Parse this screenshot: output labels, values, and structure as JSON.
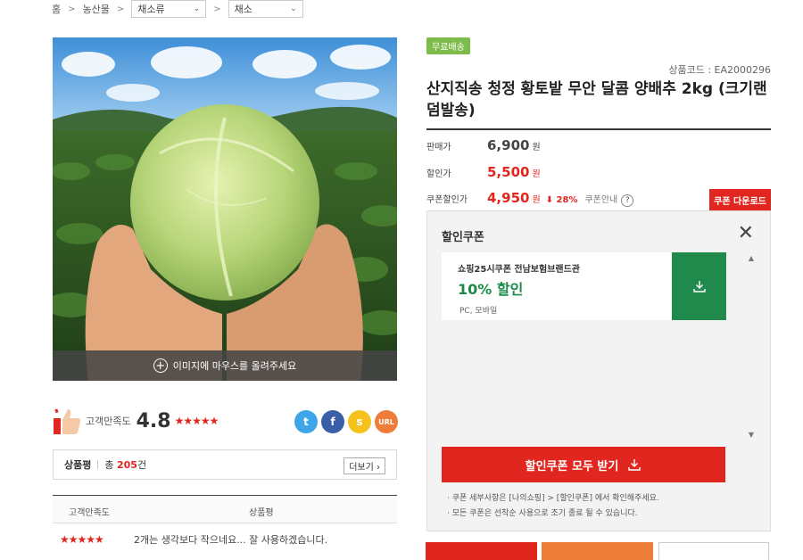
{
  "breadcrumb": {
    "home": "홈",
    "level1": "농산물",
    "level2": "채소류",
    "level3": "채소"
  },
  "image": {
    "hover_hint": "이미지에 마우스를 올려주세요"
  },
  "rating": {
    "label": "고객만족도",
    "score": "4.8",
    "stars": "★★★★★",
    "sns": {
      "twitter": "t",
      "facebook": "f",
      "kakaostory": "s",
      "url": "URL"
    }
  },
  "reviews": {
    "label": "상품평",
    "total_prefix": "총",
    "total_count": "205",
    "total_suffix": "건",
    "more": "더보기",
    "col_satisfaction": "고객만족도",
    "col_review": "상품평",
    "first_row": {
      "stars": "★★★★★",
      "text": "2개는 생각보다 작으네요... 잘 사용하겠습니다."
    }
  },
  "product": {
    "badge": "무료배송",
    "code": "상품코드 : EA2000296",
    "title": "산지직송 청정 황토밭 무안 달콤 양배추 2kg (크기랜덤발송)",
    "sale_label": "판매가",
    "sale_price": "6,900",
    "discount_label": "할인가",
    "discount_price": "5,500",
    "coupon_label": "쿠폰할인가",
    "coupon_price": "4,950",
    "coupon_pct": "⬇ 28%",
    "coupon_info": "쿠폰안내",
    "won": "원",
    "coupon_download": "쿠폰 다운로드"
  },
  "coupon_panel": {
    "title": "할인쿠폰",
    "close": "✕",
    "coupon": {
      "name": "쇼핑25시쿠폰 전남보험브랜드관",
      "discount": "10% 할인",
      "platform": "PC, 모바일"
    },
    "get_all": "할인쿠폰 모두 받기",
    "notes": [
      "· 쿠폰 세부사항은 [나의쇼핑] > [할인쿠폰] 에서 확인해주세요.",
      "· 모든 쿠폰은 선착순 사용으로 조기 종료 될 수 있습니다."
    ]
  },
  "colors": {
    "accent_red": "#e0261e",
    "coupon_green": "#1f8a4c",
    "badge_green": "#7dbb4a"
  }
}
